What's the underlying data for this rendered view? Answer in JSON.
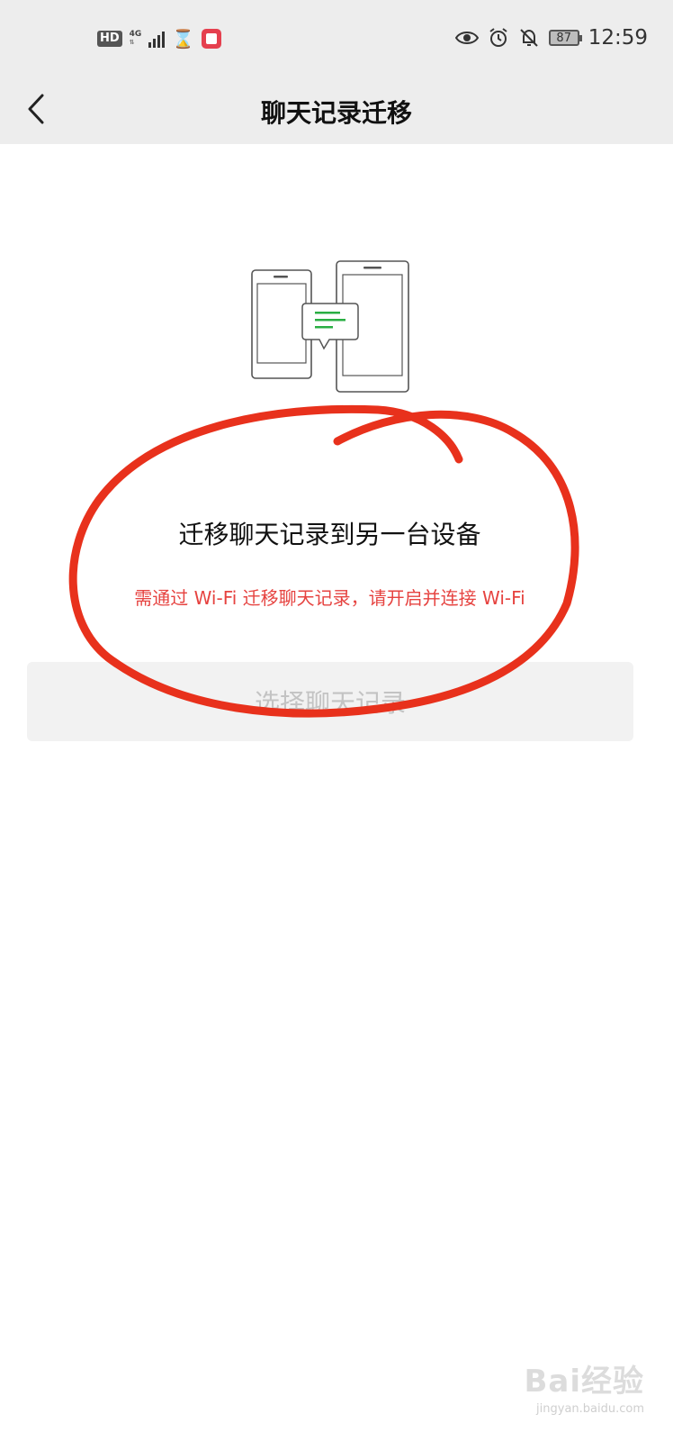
{
  "status_bar": {
    "hd_label": "HD",
    "network_label": "4G",
    "battery_level": "87",
    "time": "12:59"
  },
  "nav": {
    "title": "聊天记录迁移"
  },
  "main": {
    "headline": "迁移聊天记录到另一台设备",
    "warning": "需通过 Wi-Fi 迁移聊天记录，请开启并连接 Wi-Fi",
    "select_button_label": "选择聊天记录"
  },
  "watermark": {
    "main": "Bai经验",
    "sub": "jingyan.baidu.com"
  },
  "colors": {
    "nav_background": "#ededed",
    "warning_red": "#e64340",
    "annotation_red": "#e8311c",
    "chat_green": "#2aae43",
    "button_disabled_text": "#c3c3c3"
  }
}
